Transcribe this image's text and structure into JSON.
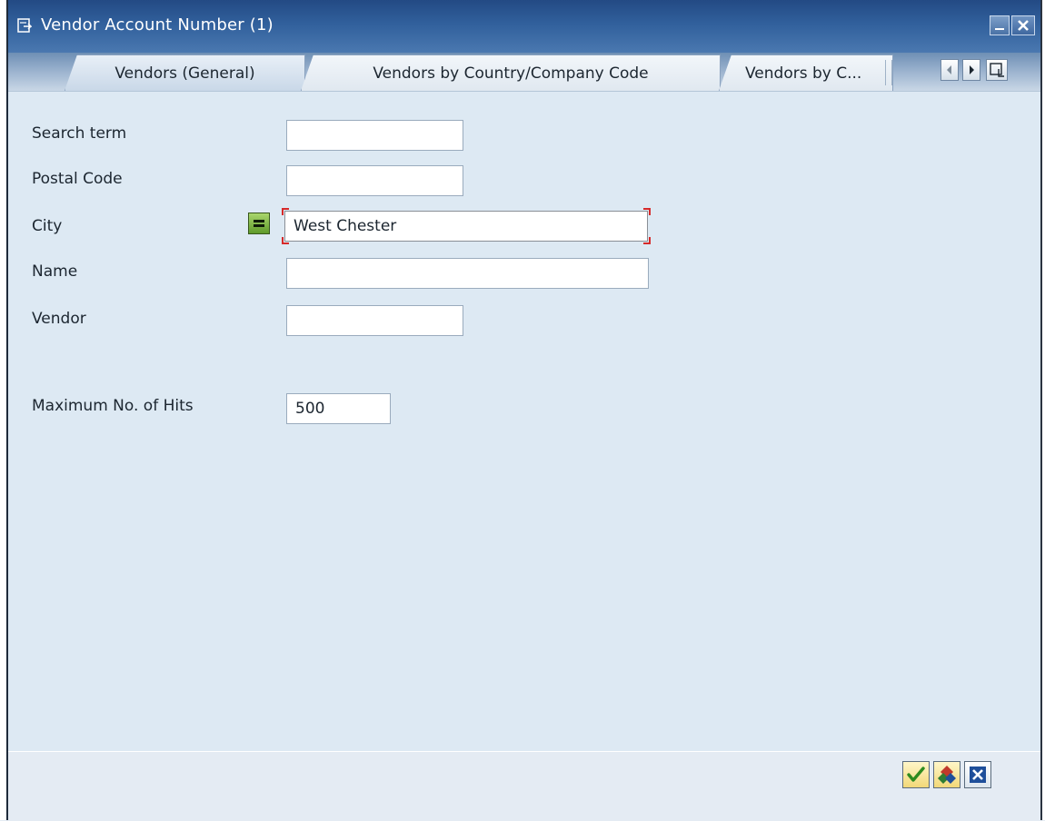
{
  "window": {
    "title": "Vendor Account Number (1)"
  },
  "tabs": [
    {
      "label": "Vendors (General)",
      "active": true
    },
    {
      "label": "Vendors by Country/Company Code",
      "active": false
    },
    {
      "label": "Vendors by C...",
      "active": false
    }
  ],
  "form": {
    "search_term": {
      "label": "Search term",
      "value": ""
    },
    "postal_code": {
      "label": "Postal Code",
      "value": ""
    },
    "city": {
      "label": "City",
      "value": "West Chester"
    },
    "name": {
      "label": "Name",
      "value": ""
    },
    "vendor": {
      "label": "Vendor",
      "value": ""
    },
    "max_hits": {
      "label": "Maximum No. of Hits",
      "value": "500"
    }
  },
  "icons": {
    "title": "window-menu-icon",
    "minimize": "minimize-icon",
    "close": "close-icon",
    "tab_prev": "arrow-left-icon",
    "tab_next": "arrow-right-icon",
    "tab_list": "tab-list-icon",
    "selection": "equals-icon",
    "ok": "checkmark-icon",
    "other": "multiple-selection-icon",
    "cancel": "cancel-icon"
  },
  "colors": {
    "title_bar": "#31609c",
    "selection_button": "#7fb84a",
    "required_marker": "#d62a2a",
    "ok_check": "#2e8b1e",
    "cancel_blue": "#1f4f9a"
  }
}
